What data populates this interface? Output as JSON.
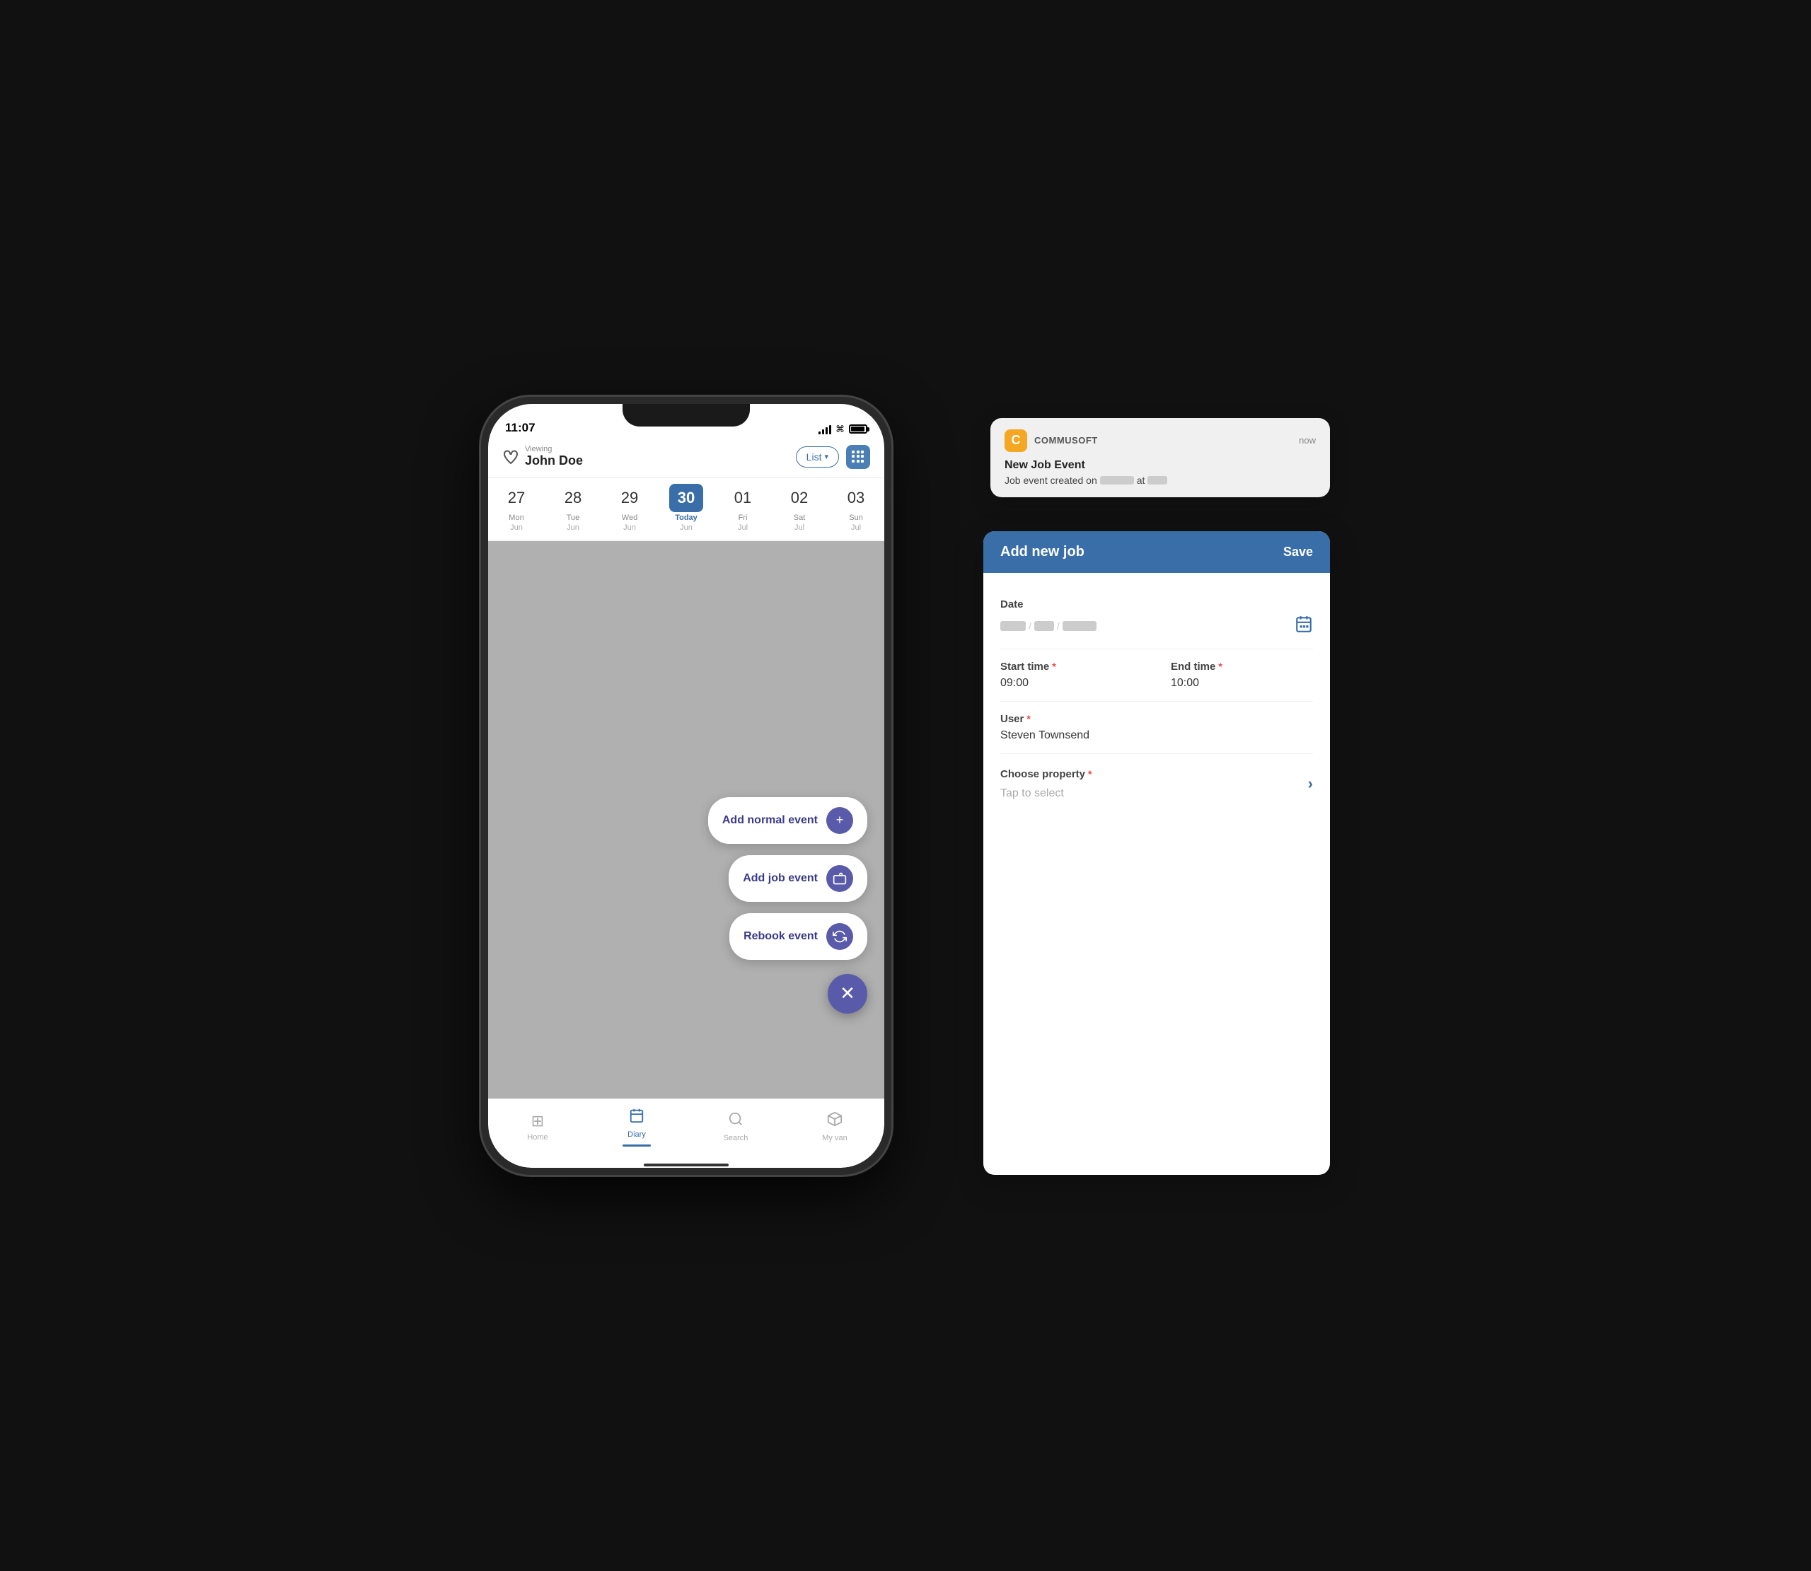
{
  "status_bar": {
    "time": "11:07",
    "signal_bars": [
      4,
      6,
      8,
      10,
      12
    ],
    "battery_label": "battery"
  },
  "header": {
    "viewing_label": "Viewing",
    "user_name": "John Doe",
    "list_btn_label": "List",
    "grid_btn_label": "grid view"
  },
  "calendar": {
    "days": [
      {
        "num": "27",
        "name": "Mon",
        "month": "Jun",
        "today": false
      },
      {
        "num": "28",
        "name": "Tue",
        "month": "Jun",
        "today": false
      },
      {
        "num": "29",
        "name": "Wed",
        "month": "Jun",
        "today": false
      },
      {
        "num": "30",
        "name": "Today",
        "month": "Jun",
        "today": true
      },
      {
        "num": "01",
        "name": "Fri",
        "month": "Jul",
        "today": false
      },
      {
        "num": "02",
        "name": "Sat",
        "month": "Jul",
        "today": false
      },
      {
        "num": "03",
        "name": "Sun",
        "month": "Jul",
        "today": false
      }
    ]
  },
  "overlay_buttons": {
    "add_normal": "Add normal event",
    "add_job": "Add job event",
    "rebook": "Rebook event"
  },
  "bottom_nav": {
    "items": [
      {
        "label": "Home",
        "icon": "⊞",
        "active": false
      },
      {
        "label": "Diary",
        "icon": "📅",
        "active": true
      },
      {
        "label": "Search",
        "icon": "🔍",
        "active": false
      },
      {
        "label": "My van",
        "icon": "🗂",
        "active": false
      }
    ]
  },
  "notification": {
    "app_name": "COMMUSOFT",
    "app_icon_letter": "C",
    "time": "now",
    "title": "New Job Event",
    "body_prefix": "Job event created on",
    "body_at": "at"
  },
  "add_job_panel": {
    "title": "Add new job",
    "save_label": "Save",
    "date_label": "Date",
    "start_time_label": "Start time",
    "start_time_required": "*",
    "start_time_value": "09:00",
    "end_time_label": "End time",
    "end_time_required": "*",
    "end_time_value": "10:00",
    "user_label": "User",
    "user_required": "*",
    "user_value": "Steven Townsend",
    "choose_property_label": "Choose property",
    "choose_property_required": "*",
    "choose_property_placeholder": "Tap to select"
  }
}
